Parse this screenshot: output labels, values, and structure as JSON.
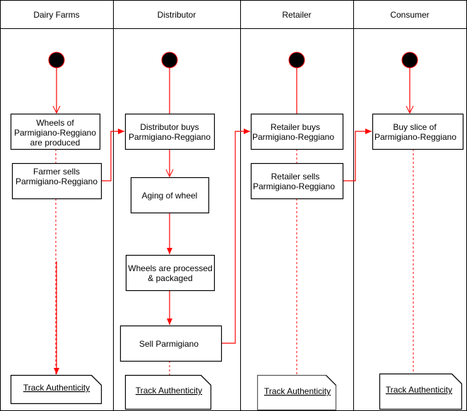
{
  "lanes": [
    {
      "label": "Dairy Farms"
    },
    {
      "label": "Distributor"
    },
    {
      "label": "Retailer"
    },
    {
      "label": "Consumer"
    }
  ],
  "activities": {
    "wheels_produced": [
      "Wheels of",
      "Parmigiano-Reggiano",
      "are produced"
    ],
    "farmer_sells": [
      "Farmer sells",
      "Parmigiano-Reggiano"
    ],
    "distributor_buys": [
      "Distributor buys",
      "Parmigiano-Reggiano"
    ],
    "aging": [
      "Aging of wheel"
    ],
    "processed": [
      "Wheels are processed",
      "& packaged"
    ],
    "sell": [
      "Sell Parmigiano"
    ],
    "retailer_buys": [
      "Retailer buys",
      "Parmigiano-Reggiano"
    ],
    "retailer_sells": [
      "Retailer sells",
      "Parmigiano-Reggiano"
    ],
    "buy_slice": [
      "Buy slice of",
      "Parmigiano-Reggiano"
    ]
  },
  "notes": [
    "Track Authenticity",
    "Track Authenticity",
    "Track Authenticity",
    "Track Authenticity"
  ],
  "colors": {
    "flow": "#ff0000",
    "start": "#000000"
  }
}
